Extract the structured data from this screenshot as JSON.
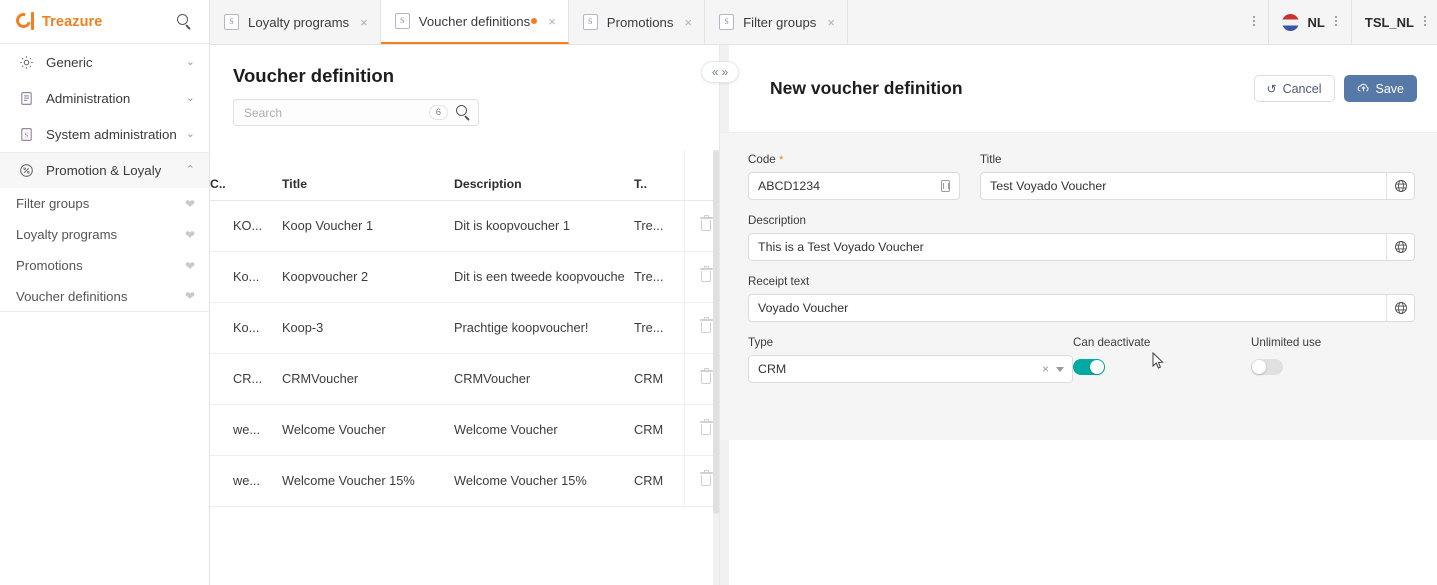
{
  "brand": {
    "name": "Treazure",
    "logo_color": "#F08020",
    "search_icon": "search-icon"
  },
  "sidebar": {
    "groups": [
      {
        "label": "Generic",
        "icon": "gear-icon",
        "chevron": "chevron-down-icon",
        "chevron_glyph": "⌄"
      },
      {
        "label": "Administration",
        "icon": "document-list-icon",
        "chevron": "chevron-down-icon",
        "chevron_glyph": "⌄"
      },
      {
        "label": "System administration",
        "icon": "document-settings-icon",
        "chevron": "chevron-down-icon",
        "chevron_glyph": "⌄"
      }
    ],
    "active_group": {
      "label": "Promotion & Loyaly",
      "icon": "percent-circle-icon",
      "chevron": "chevron-up-icon",
      "chevron_glyph": "⌃"
    },
    "sub_items": [
      {
        "label": "Filter groups",
        "favorite_icon": "heart-icon"
      },
      {
        "label": "Loyalty programs",
        "favorite_icon": "heart-icon"
      },
      {
        "label": "Promotions",
        "favorite_icon": "heart-icon"
      },
      {
        "label": "Voucher definitions",
        "favorite_icon": "heart-icon"
      }
    ]
  },
  "tabs": [
    {
      "label": "Loyalty programs",
      "active": false,
      "dirty": false
    },
    {
      "label": "Voucher definitions",
      "active": true,
      "dirty": true
    },
    {
      "label": "Promotions",
      "active": false,
      "dirty": false
    },
    {
      "label": "Filter groups",
      "active": false,
      "dirty": false
    }
  ],
  "tabbar_right": {
    "overflow_menu": "kebab-menu-icon",
    "language": {
      "code": "NL",
      "flag": "flag-nl-icon",
      "menu": "kebab-menu-icon"
    },
    "environment": {
      "label": "TSL_NL",
      "menu": "kebab-menu-icon"
    }
  },
  "list_panel": {
    "title": "Voucher definition",
    "search": {
      "placeholder": "Search",
      "value": "",
      "count": "6",
      "icon": "search-icon"
    },
    "columns": [
      "C..",
      "Title",
      "Description",
      "T..",
      ""
    ],
    "rows": [
      {
        "code": "KO...",
        "title": "Koop Voucher 1",
        "description": "Dit is koopvoucher 1",
        "type": "Tre...",
        "delete_icon": "trash-icon"
      },
      {
        "code": "Ko...",
        "title": "Koopvoucher 2",
        "description": "Dit is een tweede koopvouche",
        "type": "Tre...",
        "delete_icon": "trash-icon"
      },
      {
        "code": "Ko...",
        "title": "Koop-3",
        "description": "Prachtige koopvoucher!",
        "type": "Tre...",
        "delete_icon": "trash-icon"
      },
      {
        "code": "CR...",
        "title": "CRMVoucher",
        "description": "CRMVoucher",
        "type": "CRM",
        "delete_icon": "trash-icon"
      },
      {
        "code": "we...",
        "title": "Welcome Voucher",
        "description": "Welcome Voucher",
        "type": "CRM",
        "delete_icon": "trash-icon"
      },
      {
        "code": "we...",
        "title": "Welcome Voucher 15%",
        "description": "Welcome Voucher 15%",
        "type": "CRM",
        "delete_icon": "trash-icon"
      }
    ]
  },
  "form_panel": {
    "collapse": {
      "left_glyph": "«",
      "right_glyph": "»"
    },
    "title": "New voucher definition",
    "cancel_label": "Cancel",
    "save_label": "Save",
    "save_color": "#5779a8",
    "accent_color": "#F08020",
    "toggle_on_color": "#00a9a2",
    "fields": {
      "code": {
        "label": "Code",
        "required_marker": "*",
        "value": "ABCD1234",
        "adornment": "copy-icon"
      },
      "title": {
        "label": "Title",
        "value": "Test Voyado Voucher",
        "adornment": "globe-icon"
      },
      "description": {
        "label": "Description",
        "value": "This is a Test Voyado Voucher",
        "adornment": "globe-icon"
      },
      "receipt_text": {
        "label": "Receipt text",
        "value": "Voyado Voucher",
        "adornment": "globe-icon"
      },
      "type": {
        "label": "Type",
        "value": "CRM",
        "clear_glyph": "×"
      },
      "can_deactivate": {
        "label": "Can deactivate",
        "state": "on"
      },
      "unlimited_use": {
        "label": "Unlimited use",
        "state": "off"
      }
    }
  }
}
